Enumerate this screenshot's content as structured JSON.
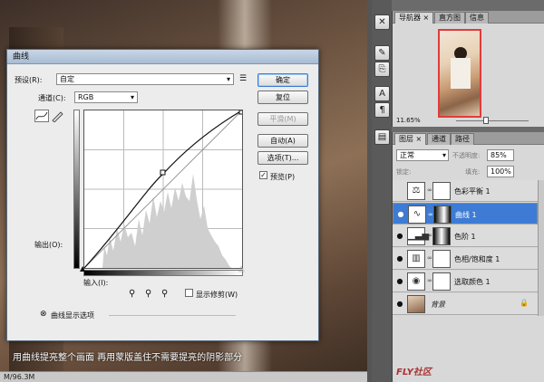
{
  "dialog": {
    "title": "曲线",
    "preset_label": "预设(R):",
    "preset_value": "自定",
    "channel_label": "通道(C):",
    "channel_value": "RGB",
    "output_label": "输出(O):",
    "input_label": "输入(I):",
    "show_clipping_label": "显示修剪(W)",
    "curve_display_label": "曲线显示选项",
    "buttons": {
      "ok": "确定",
      "reset": "复位",
      "smooth": "平滑(M)",
      "auto": "自动(A)",
      "options": "选项(T)...",
      "preview": "预览(P)"
    },
    "preview_checked": true,
    "show_clipping_checked": false
  },
  "canvas": {
    "caption": "用曲线提亮整个画面 再用蒙版盖住不需要提亮的阴影部分",
    "status": "M/96.3M"
  },
  "navigator": {
    "tabs": [
      "导航器",
      "直方图",
      "信息"
    ],
    "zoom": "11.65%"
  },
  "layers_panel": {
    "tabs": [
      "图层",
      "通道",
      "路径"
    ],
    "blend_mode": "正常",
    "opacity_label": "不透明度:",
    "opacity_value": "85%",
    "lock_label": "锁定:",
    "fill_label": "填充:",
    "fill_value": "100%",
    "layers": [
      {
        "name": "色彩平衡 1",
        "icon": "balance-icon",
        "visible": false,
        "selected": false,
        "background": false
      },
      {
        "name": "曲线 1",
        "icon": "curves-icon",
        "visible": true,
        "selected": true,
        "background": false
      },
      {
        "name": "色阶 1",
        "icon": "levels-icon",
        "visible": true,
        "selected": false,
        "background": false
      },
      {
        "name": "色相/饱和度 1",
        "icon": "hue-sat-icon",
        "visible": true,
        "selected": false,
        "background": false
      },
      {
        "name": "选取颜色 1",
        "icon": "selective-color-icon",
        "visible": true,
        "selected": false,
        "background": false
      },
      {
        "name": "背景",
        "icon": "photo-thumbnail",
        "visible": true,
        "selected": false,
        "background": true
      }
    ]
  },
  "watermark": "FLY社区"
}
